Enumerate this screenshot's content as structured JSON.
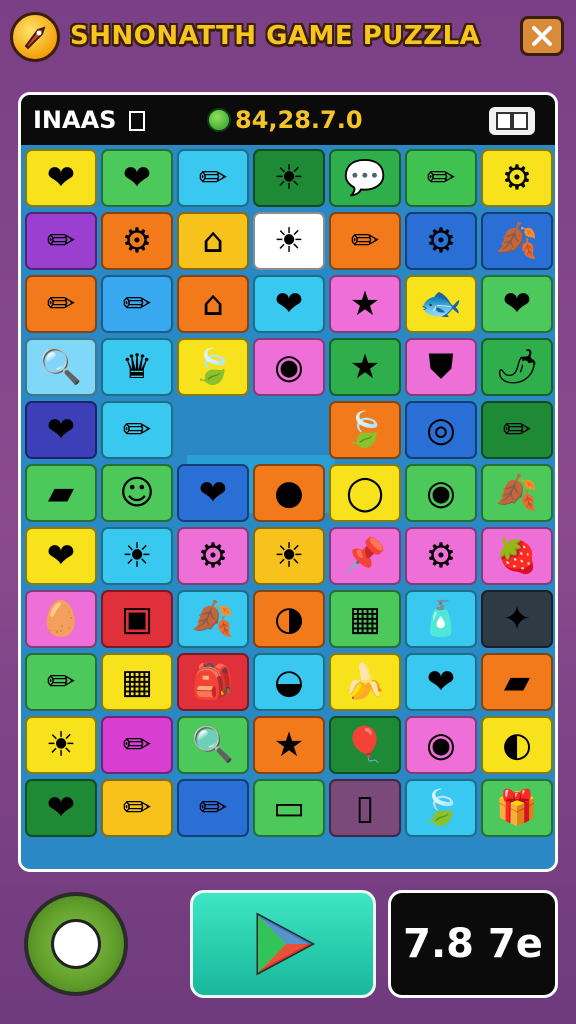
{
  "header": {
    "title": "SHNONATTH GAME PUZZLA",
    "logo_icon": "rocket-icon",
    "close_icon": "close-icon"
  },
  "hud": {
    "left_label": "INAAS",
    "left_icon": "square-icon",
    "coin_icon": "coin-icon",
    "score": "84,28.7.0",
    "menu_icon": "book-icon"
  },
  "board": {
    "rows": [
      [
        {
          "icon": "heart-icon",
          "glyph": "❤",
          "bg": "#f7e21c"
        },
        {
          "icon": "heart-icon",
          "glyph": "❤",
          "bg": "#4cc95a"
        },
        {
          "icon": "pencil-icon",
          "glyph": "✏",
          "bg": "#38c8f0"
        },
        {
          "icon": "sun-icon",
          "glyph": "☀",
          "bg": "#1f8a36"
        },
        {
          "icon": "speech-bubble-icon",
          "glyph": "💬",
          "bg": "#2fae4c"
        },
        {
          "icon": "pencil-icon",
          "glyph": "✏",
          "bg": "#3fc24f"
        },
        {
          "icon": "gear-icon",
          "glyph": "⚙",
          "bg": "#f7e21c"
        }
      ],
      [
        {
          "icon": "pencil-icon",
          "glyph": "✏",
          "bg": "#9b3fd0"
        },
        {
          "icon": "cogwheel-icon",
          "glyph": "⚙",
          "bg": "#f27a1a"
        },
        {
          "icon": "house-icon",
          "glyph": "⌂",
          "bg": "#f7c21c"
        },
        {
          "icon": "sun-icon",
          "glyph": "☀",
          "bg": "#ffffff"
        },
        {
          "icon": "pencil-icon",
          "glyph": "✏",
          "bg": "#f27a1a"
        },
        {
          "icon": "gear-icon",
          "glyph": "⚙",
          "bg": "#2a6fd6"
        },
        {
          "icon": "leaf-icon",
          "glyph": "🍂",
          "bg": "#2a6fd6"
        }
      ],
      [
        {
          "icon": "pencil-icon",
          "glyph": "✏",
          "bg": "#f27a1a"
        },
        {
          "icon": "pencil-icon",
          "glyph": "✏",
          "bg": "#38a8f0"
        },
        {
          "icon": "house-icon",
          "glyph": "⌂",
          "bg": "#f27a1a"
        },
        {
          "icon": "heart-icon",
          "glyph": "❤",
          "bg": "#38c8f0"
        },
        {
          "icon": "star-icon",
          "glyph": "★",
          "bg": "#ef6fd8"
        },
        {
          "icon": "fish-icon",
          "glyph": "🐟",
          "bg": "#f7e21c"
        },
        {
          "icon": "heart-icon",
          "glyph": "❤",
          "bg": "#4cc95a"
        }
      ],
      [
        {
          "icon": "magnifier-icon",
          "glyph": "🔍",
          "bg": "#7fd8f7"
        },
        {
          "icon": "crown-icon",
          "glyph": "♛",
          "bg": "#38c8f0"
        },
        {
          "icon": "leaf-icon",
          "glyph": "🍃",
          "bg": "#f7e21c"
        },
        {
          "icon": "ring-icon",
          "glyph": "◉",
          "bg": "#ef6fd8"
        },
        {
          "icon": "star-icon",
          "glyph": "★",
          "bg": "#2fae4c"
        },
        {
          "icon": "shield-icon",
          "glyph": "⛊",
          "bg": "#ef6fd8"
        },
        {
          "icon": "pepper-icon",
          "glyph": "🌶",
          "bg": "#2fae4c"
        }
      ],
      [
        {
          "icon": "heart-icon",
          "glyph": "❤",
          "bg": "#3d3fb8"
        },
        {
          "icon": "pencil-icon",
          "glyph": "✏",
          "bg": "#38c8f0"
        },
        {
          "icon": "empty-cell",
          "glyph": "",
          "bg": "#2a9fd6"
        },
        {
          "icon": "empty-cell",
          "glyph": "",
          "bg": "#2a9fd6"
        },
        {
          "icon": "leaf-icon",
          "glyph": "🍃",
          "bg": "#f27a1a"
        },
        {
          "icon": "wheel-icon",
          "glyph": "◎",
          "bg": "#2a6fd6"
        },
        {
          "icon": "pencil-icon",
          "glyph": "✏",
          "bg": "#1f8a36"
        }
      ],
      [
        {
          "icon": "eraser-icon",
          "glyph": "▰",
          "bg": "#4cc95a"
        },
        {
          "icon": "cat-face-icon",
          "glyph": "☺",
          "bg": "#4cc95a"
        },
        {
          "icon": "heart-icon",
          "glyph": "❤",
          "bg": "#2a6fd6"
        },
        {
          "icon": "ball-icon",
          "glyph": "●",
          "bg": "#f27a1a"
        },
        {
          "icon": "ring-icon",
          "glyph": "◯",
          "bg": "#f7e21c"
        },
        {
          "icon": "map-pin-icon",
          "glyph": "◉",
          "bg": "#4cc95a"
        },
        {
          "icon": "leaf-icon",
          "glyph": "🍂",
          "bg": "#4cc95a"
        }
      ],
      [
        {
          "icon": "heart-icon",
          "glyph": "❤",
          "bg": "#f7e21c"
        },
        {
          "icon": "sun-icon",
          "glyph": "☀",
          "bg": "#38c8f0"
        },
        {
          "icon": "gear-icon",
          "glyph": "⚙",
          "bg": "#ef6fd8"
        },
        {
          "icon": "sun-icon",
          "glyph": "☀",
          "bg": "#f7c21c"
        },
        {
          "icon": "pin-icon",
          "glyph": "📌",
          "bg": "#ef6fd8"
        },
        {
          "icon": "gear-icon",
          "glyph": "⚙",
          "bg": "#ef6fd8"
        },
        {
          "icon": "strawberry-icon",
          "glyph": "🍓",
          "bg": "#ef6fd8"
        }
      ],
      [
        {
          "icon": "egg-icon",
          "glyph": "🥚",
          "bg": "#ef6fd8"
        },
        {
          "icon": "frame-icon",
          "glyph": "▣",
          "bg": "#e0303a"
        },
        {
          "icon": "leaf-icon",
          "glyph": "🍂",
          "bg": "#38c8f0"
        },
        {
          "icon": "ball-icon",
          "glyph": "◑",
          "bg": "#f27a1a"
        },
        {
          "icon": "box-icon",
          "glyph": "▦",
          "bg": "#4cc95a"
        },
        {
          "icon": "bottle-icon",
          "glyph": "🧴",
          "bg": "#38c8f0"
        },
        {
          "icon": "sparkle-icon",
          "glyph": "✦",
          "bg": "#2e3a44"
        }
      ],
      [
        {
          "icon": "pencil-icon",
          "glyph": "✏",
          "bg": "#4cc95a"
        },
        {
          "icon": "cube-icon",
          "glyph": "▦",
          "bg": "#f7e21c"
        },
        {
          "icon": "bag-icon",
          "glyph": "🎒",
          "bg": "#e0303a"
        },
        {
          "icon": "seed-icon",
          "glyph": "◒",
          "bg": "#38c8f0"
        },
        {
          "icon": "banana-icon",
          "glyph": "🍌",
          "bg": "#f7e21c"
        },
        {
          "icon": "heart-icon",
          "glyph": "❤",
          "bg": "#38c8f0"
        },
        {
          "icon": "eraser-icon",
          "glyph": "▰",
          "bg": "#f27a1a"
        }
      ],
      [
        {
          "icon": "sun-icon",
          "glyph": "☀",
          "bg": "#f7e21c"
        },
        {
          "icon": "pencil-icon",
          "glyph": "✏",
          "bg": "#d83fd0"
        },
        {
          "icon": "magnifier-icon",
          "glyph": "🔍",
          "bg": "#4cc95a"
        },
        {
          "icon": "star-icon",
          "glyph": "★",
          "bg": "#f27a1a"
        },
        {
          "icon": "balloon-icon",
          "glyph": "🎈",
          "bg": "#1f8a36"
        },
        {
          "icon": "clock-icon",
          "glyph": "◉",
          "bg": "#ef6fd8"
        },
        {
          "icon": "shell-icon",
          "glyph": "◐",
          "bg": "#f7e21c"
        }
      ],
      [
        {
          "icon": "heart-icon",
          "glyph": "❤",
          "bg": "#1f8a36"
        },
        {
          "icon": "pencil-icon",
          "glyph": "✏",
          "bg": "#f7c21c"
        },
        {
          "icon": "pencil-icon",
          "glyph": "✏",
          "bg": "#2a6fd6"
        },
        {
          "icon": "box-icon",
          "glyph": "▭",
          "bg": "#4cc95a"
        },
        {
          "icon": "can-icon",
          "glyph": "▯",
          "bg": "#7a4a7a"
        },
        {
          "icon": "leaf-icon",
          "glyph": "🍃",
          "bg": "#38c8f0"
        },
        {
          "icon": "gift-icon",
          "glyph": "🎁",
          "bg": "#4cc95a"
        }
      ]
    ]
  },
  "footer": {
    "badge_icon": "gem-badge-icon",
    "play_icon": "play-icon",
    "timer": "7.8 7e"
  }
}
